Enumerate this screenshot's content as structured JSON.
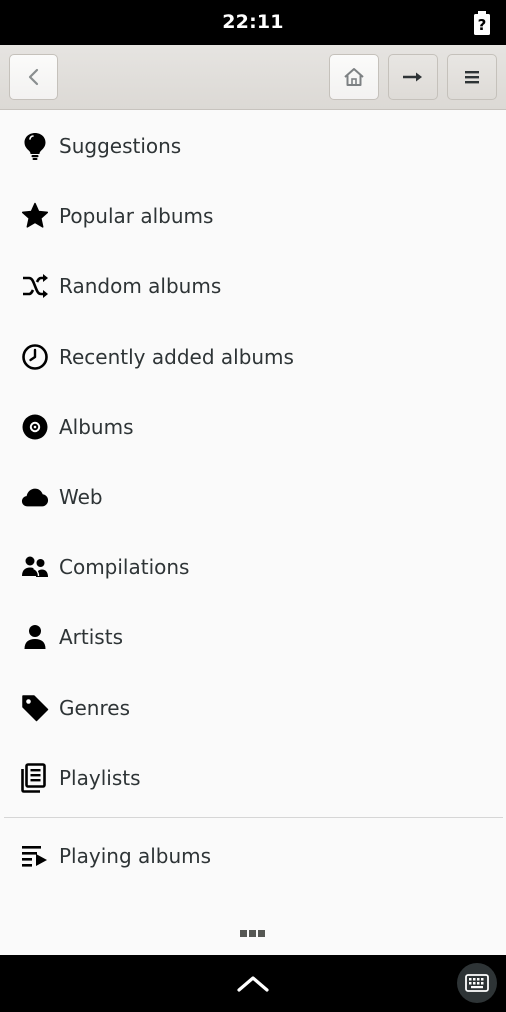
{
  "status": {
    "time": "22:11",
    "battery_icon": "battery-unknown-icon"
  },
  "header": {
    "back_icon": "chevron-left-icon",
    "home_icon": "home-icon",
    "forward_icon": "arrow-right-icon",
    "menu_icon": "hamburger-menu-icon"
  },
  "items": [
    {
      "label": "Suggestions",
      "icon": "lightbulb-icon"
    },
    {
      "label": "Popular albums",
      "icon": "star-icon"
    },
    {
      "label": "Random albums",
      "icon": "shuffle-icon"
    },
    {
      "label": "Recently added albums",
      "icon": "clock-icon"
    },
    {
      "label": "Albums",
      "icon": "disc-icon"
    },
    {
      "label": "Web",
      "icon": "cloud-icon"
    },
    {
      "label": "Compilations",
      "icon": "people-icon"
    },
    {
      "label": "Artists",
      "icon": "person-icon"
    },
    {
      "label": "Genres",
      "icon": "tag-icon"
    },
    {
      "label": "Playlists",
      "icon": "playlists-icon"
    }
  ],
  "playing": {
    "label": "Playing albums",
    "icon": "playlist-play-icon"
  },
  "bottom": {
    "more_icon": "more-dots-icon",
    "chevron_icon": "chevron-up-icon",
    "keyboard_icon": "keyboard-icon"
  }
}
